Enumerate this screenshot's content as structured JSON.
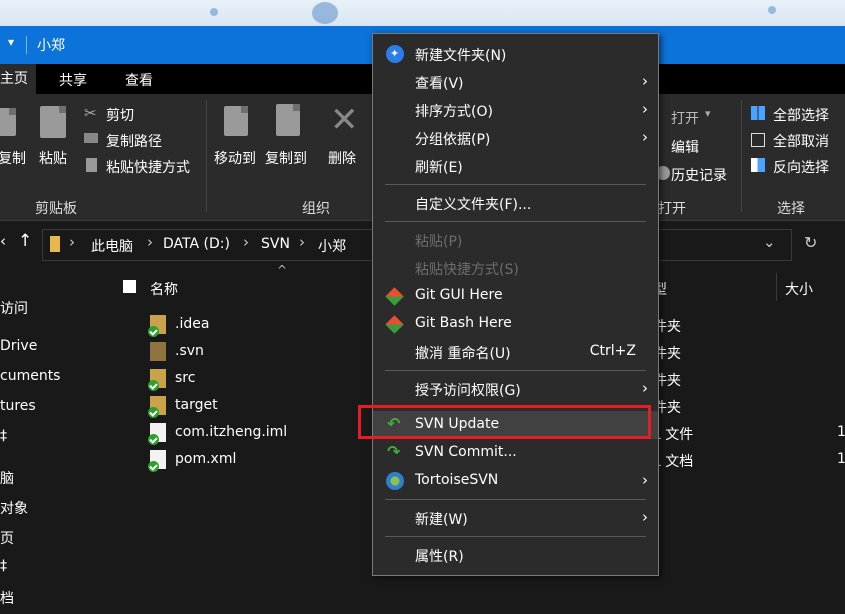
{
  "window": {
    "title": "小郑"
  },
  "ribbon_tabs": [
    "主页",
    "共享",
    "查看"
  ],
  "clipboard": {
    "copy": "复制",
    "paste": "粘贴",
    "cut": "剪切",
    "copy_path": "复制路径",
    "paste_shortcut": "粘贴快捷方式",
    "group": "剪贴板"
  },
  "organize": {
    "move_to": "移动到",
    "copy_to": "复制到",
    "delete": "删除",
    "group": "组织"
  },
  "open_group": {
    "open": "打开",
    "edit": "编辑",
    "history": "历史记录",
    "group": "打开"
  },
  "select_group": {
    "select_all": "全部选择",
    "select_none": "全部取消",
    "invert": "反向选择",
    "group": "选择"
  },
  "breadcrumb": [
    "此电脑",
    "DATA (D:)",
    "SVN",
    "小郑"
  ],
  "nav_pane": [
    "访问",
    "Drive",
    "cuments",
    "tures",
    "‡",
    "脑",
    "对象",
    "页",
    "‡",
    "档"
  ],
  "list": {
    "columns": {
      "name": "名称",
      "type": "型",
      "size": "大小"
    },
    "files": [
      {
        "name": ".idea",
        "type": "件夹",
        "size": "",
        "icon": "folder-svn-ok"
      },
      {
        "name": ".svn",
        "type": "件夹",
        "size": "",
        "icon": "folder-plain"
      },
      {
        "name": "src",
        "type": "件夹",
        "size": "",
        "icon": "folder-svn-ok"
      },
      {
        "name": "target",
        "type": "件夹",
        "size": "",
        "icon": "folder-svn-ok"
      },
      {
        "name": "com.itzheng.iml",
        "type": "L 文件",
        "size": "1",
        "icon": "file-svn-ok"
      },
      {
        "name": "pom.xml",
        "type": "L 文档",
        "size": "1",
        "icon": "file-svn-ok"
      }
    ]
  },
  "context_menu": {
    "items": [
      {
        "label": "新建文件夹(N)",
        "icon": "new-folder-icon",
        "submenu": false,
        "disabled": false,
        "shortcut": ""
      },
      {
        "label": "查看(V)",
        "icon": "",
        "submenu": true,
        "disabled": false,
        "shortcut": ""
      },
      {
        "label": "排序方式(O)",
        "icon": "",
        "submenu": true,
        "disabled": false,
        "shortcut": ""
      },
      {
        "label": "分组依据(P)",
        "icon": "",
        "submenu": true,
        "disabled": false,
        "shortcut": ""
      },
      {
        "label": "刷新(E)",
        "icon": "",
        "submenu": false,
        "disabled": false,
        "shortcut": ""
      },
      {
        "label": "自定义文件夹(F)...",
        "icon": "",
        "submenu": false,
        "disabled": false,
        "shortcut": ""
      },
      {
        "label": "粘贴(P)",
        "icon": "",
        "submenu": false,
        "disabled": true,
        "shortcut": ""
      },
      {
        "label": "粘贴快捷方式(S)",
        "icon": "",
        "submenu": false,
        "disabled": true,
        "shortcut": ""
      },
      {
        "label": "Git GUI Here",
        "icon": "git-icon",
        "submenu": false,
        "disabled": false,
        "shortcut": ""
      },
      {
        "label": "Git Bash Here",
        "icon": "git-icon",
        "submenu": false,
        "disabled": false,
        "shortcut": ""
      },
      {
        "label": "撤消 重命名(U)",
        "icon": "",
        "submenu": false,
        "disabled": false,
        "shortcut": "Ctrl+Z"
      },
      {
        "label": "授予访问权限(G)",
        "icon": "",
        "submenu": true,
        "disabled": false,
        "shortcut": ""
      },
      {
        "label": "SVN Update",
        "icon": "svn-update-icon",
        "submenu": false,
        "disabled": false,
        "shortcut": ""
      },
      {
        "label": "SVN Commit...",
        "icon": "svn-commit-icon",
        "submenu": false,
        "disabled": false,
        "shortcut": ""
      },
      {
        "label": "TortoiseSVN",
        "icon": "tortoisesvn-icon",
        "submenu": true,
        "disabled": false,
        "shortcut": ""
      },
      {
        "label": "新建(W)",
        "icon": "",
        "submenu": true,
        "disabled": false,
        "shortcut": ""
      },
      {
        "label": "属性(R)",
        "icon": "",
        "submenu": false,
        "disabled": false,
        "shortcut": ""
      }
    ]
  },
  "colors": {
    "accent": "#0b73d9",
    "highlight_box": "#e51e25",
    "menu_bg": "#2b2b2b",
    "svn_ok": "#2ca02c"
  }
}
